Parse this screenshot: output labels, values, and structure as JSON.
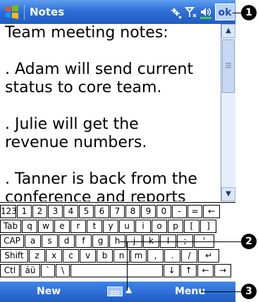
{
  "app": {
    "title": "Notes",
    "ok_label": "ok"
  },
  "status_icons": {
    "connectivity": "connectivity-icon",
    "signal": "signal-icon",
    "volume": "volume-icon"
  },
  "document": {
    "lines": [
      "Team meeting notes:",
      "",
      ". Adam will send current",
      "status to core team.",
      "",
      ". Julie will get the",
      "revenue numbers.",
      "",
      ". Tanner is back from the",
      "conference and reports"
    ]
  },
  "keyboard": {
    "row1": [
      "123",
      "1",
      "2",
      "3",
      "4",
      "5",
      "6",
      "7",
      "8",
      "9",
      "0",
      "-",
      "=",
      "←"
    ],
    "row2": [
      "Tab",
      "q",
      "w",
      "e",
      "r",
      "t",
      "y",
      "u",
      "i",
      "o",
      "p",
      "[",
      "]"
    ],
    "row3": [
      "CAP",
      "a",
      "s",
      "d",
      "f",
      "g",
      "h",
      "j",
      "k",
      "l",
      ";",
      "'"
    ],
    "row4": [
      "Shift",
      "z",
      "x",
      "c",
      "v",
      "b",
      "n",
      "m",
      ",",
      ".",
      "/",
      "↵"
    ],
    "row5": [
      "Ctl",
      "áü",
      "`",
      "\\",
      "",
      "↓",
      "↑",
      "←",
      "→"
    ]
  },
  "menubar": {
    "new_label": "New",
    "menu_label": "Menu",
    "sip_arrow": "▲"
  },
  "callouts": [
    "1",
    "2",
    "3"
  ]
}
